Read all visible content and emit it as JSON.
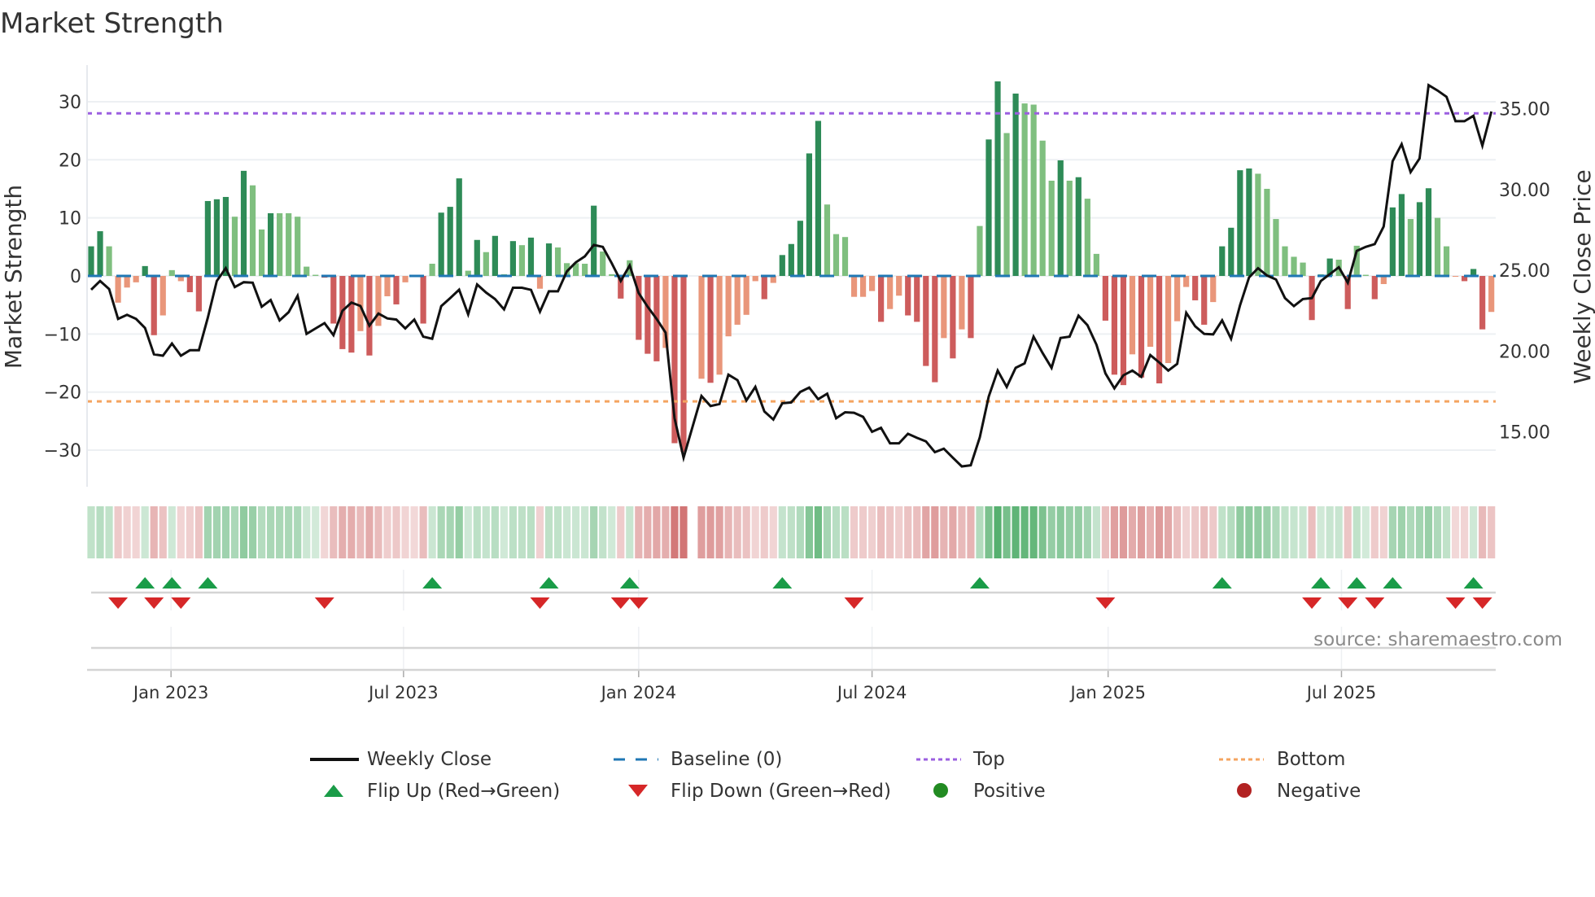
{
  "header": {
    "title": "Market Strength"
  },
  "source_note": "source: sharemaestro.com",
  "colors": {
    "pos_strong": "#2e8b57",
    "pos_weak": "#7fbf7f",
    "neg_strong": "#cd5c5c",
    "neg_weak": "#e9967a",
    "baseline": "#1f77b4",
    "top": "#9b5fe0",
    "bottom": "#f4a460",
    "line": "#111111",
    "flip_up": "#1a9c48",
    "flip_down": "#d62728",
    "positive": "#228b22",
    "negative": "#b22222"
  },
  "chart_data": {
    "type": "bar",
    "title": "Market Strength",
    "xlabel": "",
    "ylabel": "Market Strength",
    "y2label": "Weekly Close Price",
    "ylim": [
      -36.3,
      36.3
    ],
    "y2lim": [
      11.6,
      37.7
    ],
    "grid": true,
    "legend_position": "bottom",
    "left_axis": {
      "ticks": [
        30,
        20,
        10,
        0,
        -10,
        -20,
        -30
      ],
      "tick_labels": [
        "30",
        "20",
        "10",
        "0",
        "−10",
        "−20",
        "−30"
      ]
    },
    "right_axis": {
      "ticks": [
        35,
        30,
        25,
        20,
        15
      ],
      "tick_labels": [
        "35.00",
        "30.00",
        "25.00",
        "20.00",
        "15.00"
      ]
    },
    "x_ticks": [
      {
        "week_index": 8.9,
        "label": "Jan 2023"
      },
      {
        "week_index": 34.8,
        "label": "Jul 2023"
      },
      {
        "week_index": 61.0,
        "label": "Jan 2024"
      },
      {
        "week_index": 87.0,
        "label": "Jul 2024"
      },
      {
        "week_index": 113.3,
        "label": "Jan 2025"
      },
      {
        "week_index": 139.3,
        "label": "Jul 2025"
      }
    ],
    "top_level": 28,
    "bottom_level": -21.6,
    "baseline_level": 0,
    "strength": [
      5.1,
      7.7,
      5.1,
      -4.6,
      -2.0,
      -1.1,
      1.7,
      -10.2,
      -6.8,
      1.0,
      -0.9,
      -2.8,
      -6.1,
      12.9,
      13.2,
      13.6,
      10.2,
      18.1,
      15.6,
      8.0,
      10.8,
      10.8,
      10.8,
      10.2,
      1.6,
      0.2,
      -0.3,
      -8.2,
      -12.6,
      -13.2,
      -9.5,
      -13.7,
      -8.6,
      -3.5,
      -4.9,
      -1.1,
      -0.1,
      -8.2,
      2.1,
      10.9,
      11.9,
      16.8,
      0.9,
      6.2,
      4.1,
      6.9,
      0.3,
      6.0,
      5.3,
      6.6,
      -2.2,
      5.6,
      4.9,
      2.2,
      2.2,
      2.1,
      12.1,
      4.2,
      0.3,
      -3.9,
      2.7,
      -11.0,
      -13.4,
      -14.7,
      -12.4,
      -28.8,
      -30.3,
      null,
      -17.7,
      -18.4,
      -17.0,
      -10.4,
      -8.4,
      -6.7,
      -0.9,
      -4.0,
      -1.2,
      3.6,
      5.5,
      9.5,
      21.1,
      26.7,
      12.3,
      7.2,
      6.7,
      -3.6,
      -3.6,
      -2.6,
      -7.9,
      -5.7,
      -3.4,
      -6.8,
      -7.9,
      -15.5,
      -18.3,
      -10.7,
      -14.2,
      -9.2,
      -10.7,
      8.6,
      23.5,
      33.5,
      24.6,
      31.4,
      29.7,
      29.5,
      23.3,
      16.4,
      19.9,
      16.4,
      17.0,
      13.3,
      3.8,
      -7.7,
      -17.0,
      -18.8,
      -13.5,
      -17.5,
      -12.2,
      -18.5,
      -15.0,
      -7.8,
      -1.9,
      -4.2,
      -8.4,
      -4.5,
      5.1,
      8.3,
      18.2,
      18.5,
      17.6,
      15.0,
      9.8,
      5.1,
      3.3,
      2.3,
      -7.6,
      0.3,
      3.0,
      2.8,
      -5.7,
      5.2,
      0.2,
      -4.0,
      -1.4,
      11.8,
      14.1,
      9.8,
      12.7,
      15.1,
      10.0,
      5.1,
      -0.1,
      -0.9,
      1.2,
      -9.2,
      -6.2
    ],
    "weekly_close": [
      23.8,
      24.34,
      23.84,
      21.99,
      22.24,
      21.99,
      21.43,
      19.8,
      19.71,
      20.47,
      19.71,
      20.05,
      20.05,
      22.07,
      24.34,
      25.13,
      23.96,
      24.26,
      24.23,
      22.74,
      23.16,
      21.9,
      22.41,
      23.42,
      21.06,
      21.4,
      21.73,
      20.98,
      22.49,
      23.0,
      22.79,
      21.57,
      22.32,
      22.02,
      21.95,
      21.4,
      21.95,
      20.89,
      20.76,
      22.78,
      23.28,
      23.8,
      22.27,
      24.12,
      23.62,
      23.22,
      22.58,
      23.92,
      23.92,
      23.79,
      22.44,
      23.7,
      23.7,
      24.93,
      25.49,
      25.86,
      26.57,
      26.45,
      25.44,
      24.34,
      25.3,
      23.59,
      22.74,
      21.99,
      21.14,
      15.84,
      13.4,
      null,
      17.22,
      16.6,
      16.72,
      18.54,
      18.2,
      16.94,
      17.78,
      16.26,
      15.76,
      16.77,
      16.82,
      17.47,
      17.74,
      17.02,
      17.36,
      15.84,
      16.21,
      16.18,
      15.93,
      15.0,
      15.25,
      14.29,
      14.29,
      14.88,
      14.63,
      14.41,
      13.74,
      13.96,
      13.4,
      12.86,
      12.93,
      14.66,
      17.19,
      18.79,
      17.78,
      18.96,
      19.24,
      20.89,
      19.88,
      18.96,
      20.81,
      20.89,
      22.19,
      21.6,
      20.39,
      18.62,
      17.69,
      18.5,
      18.79,
      18.4,
      19.75,
      19.29,
      18.79,
      19.21,
      22.37,
      21.53,
      21.06,
      21.03,
      21.9,
      20.76,
      22.83,
      24.56,
      25.13,
      24.68,
      24.43,
      23.28,
      22.78,
      23.22,
      23.28,
      24.34,
      24.76,
      25.19,
      24.23,
      26.2,
      26.45,
      26.62,
      27.71,
      31.75,
      32.81,
      31.08,
      31.92,
      36.46,
      36.13,
      35.74,
      34.23,
      34.23,
      34.56,
      32.71,
      34.83
    ],
    "flip_up_weeks": [
      6,
      9,
      13,
      38,
      51,
      60,
      77,
      99,
      126,
      137,
      141,
      145,
      154
    ],
    "flip_down_weeks": [
      3,
      7,
      10,
      26,
      50,
      59,
      61,
      85,
      113,
      136,
      140,
      143,
      152,
      155
    ],
    "legend": [
      {
        "label": "Weekly Close",
        "symbol": "line"
      },
      {
        "label": "Baseline (0)",
        "symbol": "dash"
      },
      {
        "label": "Top",
        "symbol": "dot-purple"
      },
      {
        "label": "Bottom",
        "symbol": "dot-orange"
      },
      {
        "label": "Flip Up (Red→Green)",
        "symbol": "triangle-up"
      },
      {
        "label": "Flip Down (Green→Red)",
        "symbol": "triangle-down"
      },
      {
        "label": "Positive",
        "symbol": "circle-green"
      },
      {
        "label": "Negative",
        "symbol": "circle-red"
      }
    ]
  }
}
